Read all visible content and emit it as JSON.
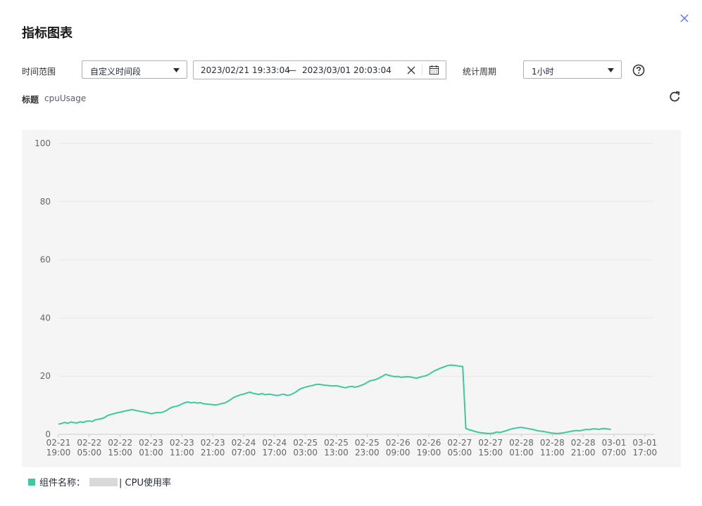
{
  "dialog": {
    "title": "指标图表"
  },
  "filters": {
    "time_range_label": "时间范围",
    "time_range_value": "自定义时间段",
    "start": "2023/02/21 19:33:04",
    "separator": "—",
    "end": "2023/03/01 20:03:04",
    "period_label": "统计周期",
    "period_value": "1小时"
  },
  "metric": {
    "title_label": "标题",
    "title_value": "cpuUsage"
  },
  "legend": {
    "prefix": "组件名称：",
    "suffix": "| CPU使用率"
  },
  "colors": {
    "line": "#3cc8a0",
    "grid": "#e8e8e8",
    "panel": "#f5f5f5",
    "text": "#666666"
  },
  "icons": [
    "close-icon",
    "chevron-down-icon",
    "clear-icon",
    "calendar-icon",
    "help-icon",
    "refresh-icon"
  ],
  "chart_data": {
    "type": "line",
    "ylim": [
      0,
      100
    ],
    "yticks": [
      0,
      20,
      40,
      60,
      80,
      100
    ],
    "grid": true,
    "x_start": "2023-02-21 19:00",
    "x_end": "2023-03-01 20:00",
    "x_step_hours": 1,
    "xtick_labels": [
      [
        "02-21",
        "19:00"
      ],
      [
        "02-22",
        "05:00"
      ],
      [
        "02-22",
        "15:00"
      ],
      [
        "02-23",
        "01:00"
      ],
      [
        "02-23",
        "11:00"
      ],
      [
        "02-23",
        "21:00"
      ],
      [
        "02-24",
        "07:00"
      ],
      [
        "02-24",
        "17:00"
      ],
      [
        "02-25",
        "03:00"
      ],
      [
        "02-25",
        "13:00"
      ],
      [
        "02-25",
        "23:00"
      ],
      [
        "02-26",
        "09:00"
      ],
      [
        "02-26",
        "19:00"
      ],
      [
        "02-27",
        "05:00"
      ],
      [
        "02-27",
        "15:00"
      ],
      [
        "02-28",
        "01:00"
      ],
      [
        "02-28",
        "11:00"
      ],
      [
        "02-28",
        "21:00"
      ],
      [
        "03-01",
        "07:00"
      ],
      [
        "03-01",
        "17:00"
      ]
    ],
    "series": [
      {
        "name": "CPU使用率",
        "values": [
          3.5,
          3.7,
          4.1,
          3.8,
          4.2,
          4.0,
          3.9,
          4.3,
          4.1,
          4.5,
          4.6,
          4.4,
          5.0,
          5.2,
          5.4,
          5.8,
          6.5,
          6.8,
          7.1,
          7.4,
          7.6,
          7.9,
          8.1,
          8.3,
          8.5,
          8.2,
          8.0,
          7.8,
          7.6,
          7.4,
          7.1,
          7.3,
          7.5,
          7.4,
          7.7,
          8.2,
          8.9,
          9.4,
          9.6,
          9.9,
          10.4,
          10.9,
          11.1,
          10.8,
          11.0,
          10.7,
          10.9,
          10.5,
          10.4,
          10.3,
          10.2,
          10.1,
          10.3,
          10.6,
          10.8,
          11.4,
          12.1,
          12.8,
          13.2,
          13.6,
          13.8,
          14.2,
          14.5,
          14.1,
          13.9,
          13.7,
          14.0,
          13.6,
          13.8,
          13.7,
          13.5,
          13.3,
          13.6,
          13.8,
          13.4,
          13.5,
          14.0,
          14.6,
          15.4,
          15.9,
          16.2,
          16.5,
          16.7,
          17.0,
          17.2,
          17.1,
          16.9,
          16.8,
          16.7,
          16.6,
          16.7,
          16.5,
          16.2,
          16.0,
          16.3,
          16.5,
          16.2,
          16.4,
          16.8,
          17.2,
          17.8,
          18.4,
          18.6,
          18.9,
          19.4,
          20.0,
          20.6,
          20.3,
          20.0,
          19.8,
          19.9,
          19.6,
          19.7,
          19.8,
          19.7,
          19.5,
          19.3,
          19.6,
          19.9,
          20.1,
          20.6,
          21.3,
          21.9,
          22.4,
          22.8,
          23.2,
          23.6,
          23.8,
          23.7,
          23.6,
          23.4,
          23.3,
          2.0,
          1.6,
          1.3,
          1.0,
          0.7,
          0.5,
          0.4,
          0.3,
          0.3,
          0.4,
          0.8,
          0.6,
          0.9,
          1.2,
          1.6,
          1.9,
          2.1,
          2.3,
          2.4,
          2.2,
          2.0,
          1.8,
          1.6,
          1.3,
          1.1,
          1.0,
          0.8,
          0.6,
          0.4,
          0.3,
          0.3,
          0.4,
          0.6,
          0.8,
          1.0,
          1.2,
          1.3,
          1.2,
          1.5,
          1.7,
          1.6,
          1.8,
          1.9,
          1.7,
          1.9,
          2.0,
          1.8,
          1.7
        ]
      }
    ]
  }
}
